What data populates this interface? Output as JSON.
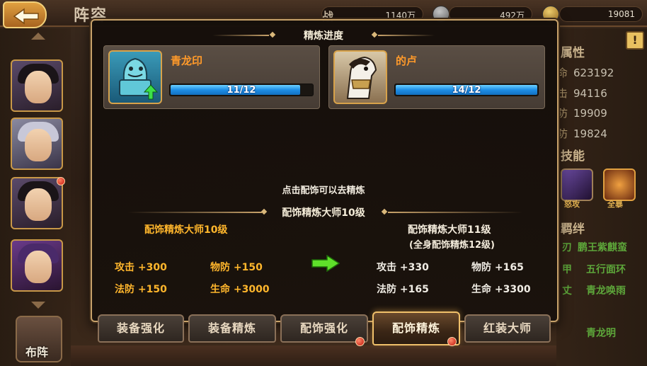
{
  "screen": {
    "title": "阵容",
    "stats": [
      {
        "label": "战",
        "value": "1140万"
      },
      {
        "label": "",
        "value": "492万"
      },
      {
        "label": "",
        "value": "19081"
      }
    ]
  },
  "hero_panel": {
    "attr_title": "属性",
    "attrs": [
      {
        "key": "命",
        "value": "623192"
      },
      {
        "key": "击",
        "value": "94116"
      },
      {
        "key": "防",
        "value": "19909"
      },
      {
        "key": "防",
        "value": "19824"
      }
    ],
    "skill_title": "技能",
    "skill_names": [
      "怒攻",
      "全暴"
    ],
    "fate_title": "羁绊",
    "fates": [
      "刃",
      "鹏王紫麒蛮",
      "甲",
      "五行面环",
      "丈",
      "青龙唤雨",
      "青龙明"
    ]
  },
  "formation_label": "布阵",
  "modal": {
    "title": "精炼进度",
    "items": [
      {
        "name": "青龙印",
        "progress_text": "11/12",
        "progress": 0.9167,
        "icon": "qinglong-seal-icon"
      },
      {
        "name": "的卢",
        "progress_text": "14/12",
        "progress": 1.0,
        "icon": "dilu-horse-icon"
      }
    ],
    "hint": "点击配饰可以去精炼",
    "master_section_title": "配饰精炼大师10级",
    "current": {
      "title": "配饰精炼大师10级",
      "attrs": [
        {
          "label": "攻击",
          "value": "+300"
        },
        {
          "label": "物防",
          "value": "+150"
        },
        {
          "label": "法防",
          "value": "+150"
        },
        {
          "label": "生命",
          "value": "+3000"
        }
      ]
    },
    "next": {
      "title": "配饰精炼大师11级",
      "subtitle": "(全身配饰精炼12级)",
      "attrs": [
        {
          "label": "攻击",
          "value": "+330"
        },
        {
          "label": "物防",
          "value": "+165"
        },
        {
          "label": "法防",
          "value": "+165"
        },
        {
          "label": "生命",
          "value": "+3300"
        }
      ]
    }
  },
  "tabs": [
    {
      "label": "装备强化",
      "active": false,
      "badge": false
    },
    {
      "label": "装备精炼",
      "active": false,
      "badge": false
    },
    {
      "label": "配饰强化",
      "active": false,
      "badge": true
    },
    {
      "label": "配饰精炼",
      "active": true,
      "badge": true
    },
    {
      "label": "红装大师",
      "active": false,
      "badge": false
    }
  ],
  "colors": {
    "frame_gold": "#c8a26a",
    "item_name_orange": "#ff9a2a",
    "current_attr_gold": "#ffb62c",
    "bar_blue": "#1e8ee6",
    "arrow_green": "#5fe02a"
  }
}
